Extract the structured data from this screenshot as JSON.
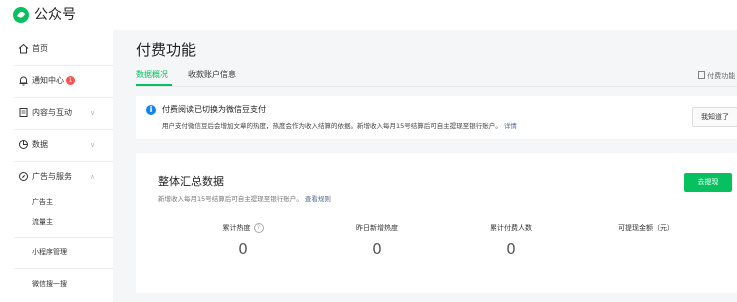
{
  "app": {
    "brand": "公众号"
  },
  "sidebar": {
    "home": "首页",
    "notifications": "通知中心",
    "notifications_badge": "1",
    "content": "内容与互动",
    "data": "数据",
    "ads_services": "广告与服务",
    "sub_items": [
      "广告主",
      "流量主",
      "小程序管理",
      "微信搜一搜"
    ]
  },
  "main": {
    "title": "付费功能",
    "tabs": [
      "数据概况",
      "收款账户信息"
    ],
    "help_link": "付费功能",
    "notice": {
      "title": "付费阅读已切换为微信豆支付",
      "desc": "用户支付微信豆后会增加文章的热度，热度会作为收入结算的依据。新增收入每月15号结算后可自主提现至银行账户。",
      "link": "详情",
      "ack_button": "我知道了"
    },
    "summary": {
      "title": "整体汇总数据",
      "subtitle": "新增收入每月15号结算后可自主提现至银行账户。",
      "subtitle_link": "查看规则",
      "withdraw_button": "去提现",
      "metrics": [
        {
          "label": "累计热度",
          "value": "0"
        },
        {
          "label": "昨日新增热度",
          "value": "0"
        },
        {
          "label": "累计付费人数",
          "value": "0"
        },
        {
          "label": "可提现金额（元）",
          "value": ""
        }
      ]
    }
  },
  "colors": {
    "accent": "#07c160",
    "info": "#1485ee",
    "badge": "#fa5151",
    "link": "#576b95"
  }
}
